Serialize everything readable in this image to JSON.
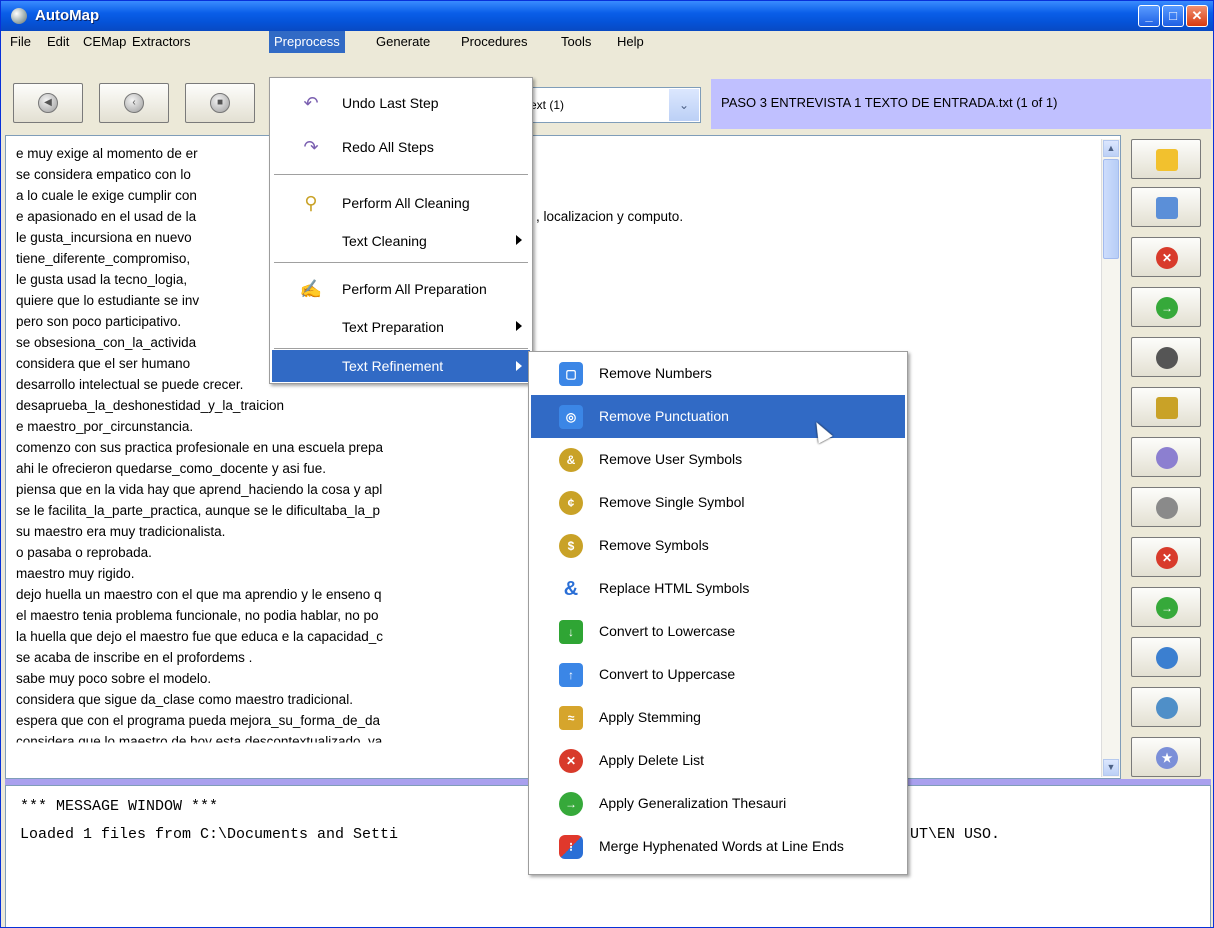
{
  "window": {
    "title": "AutoMap",
    "min_glyph": "_",
    "max_glyph": "□",
    "close_glyph": "✕"
  },
  "menubar": [
    {
      "label": "File"
    },
    {
      "label": "Edit"
    },
    {
      "label": "CEMap"
    },
    {
      "label": "Extractors"
    },
    {
      "label": "Preprocess"
    },
    {
      "label": "Generate"
    },
    {
      "label": "Procedures"
    },
    {
      "label": "Tools"
    },
    {
      "label": "Help"
    }
  ],
  "toolbar": {
    "nav_icons": [
      "first-icon",
      "previous-icon",
      "stop-icon"
    ],
    "file_select_value": "ext (1)",
    "combo_arrow": "⌄",
    "current_file": "PASO 3 ENTREVISTA 1 TEXTO DE ENTRADA.txt   (1 of 1)"
  },
  "text_lines": [
    "e muy exige al momento de er",
    "se considera empatico con lo",
    "a lo cuale le exige cumplir con",
    " e apasionado en el usad de la",
    " le gusta_incursiona en nuevo",
    " tiene_diferente_compromiso,",
    "le gusta usad la tecno_logia,",
    "quiere que lo estudiante se inv",
    "pero son poco participativo.",
    "se obsesiona_con_la_activida",
    "considera que el ser humano",
    " desarrollo intelectual se puede crecer.",
    "desaprueba_la_deshonestidad_y_la_traicion",
    "e maestro_por_circunstancia.",
    "comenzo con sus practica profesionale en una escuela prepa",
    "ahi le ofrecieron quedarse_como_docente y asi fue.",
    "piensa que en la vida hay que aprend_haciendo la cosa y apl",
    "se le facilita_la_parte_practica, aunque se le dificultaba_la_p",
    "su maestro era muy tradicionalista.",
    "o pasaba o reprobada.",
    "maestro muy rigido.",
    "dejo huella un maestro con el que ma aprendio y le enseno q",
    "el maestro tenia problema funcionale, no podia hablar, no po",
    "la huella que dejo el maestro fue que educa e la capacidad_c",
    "se acaba de inscribe en el profordems .",
    "sabe muy poco sobre el modelo.",
    "considera que sigue da_clase como maestro tradicional.",
    "espera que con el programa pueda mejora_su_forma_de_da",
    "considera que lo maestro de hoy esta descontextualizado, ya"
  ],
  "text_fragment": ", localizacion y computo.",
  "scrollbar": {
    "up": "▲",
    "down": "▼"
  },
  "right_tools": [
    {
      "icon": "open-folder-icon",
      "color": "#f2c12e",
      "glyph": ""
    },
    {
      "icon": "folder-image-icon",
      "color": "#5b8fd8",
      "glyph": ""
    },
    {
      "icon": "delete-list-icon",
      "color": "#d83b2b",
      "glyph": "✕"
    },
    {
      "icon": "thesaurus-icon",
      "color": "#36a93a",
      "glyph": "→"
    },
    {
      "icon": "stamp-icon",
      "color": "#555555",
      "glyph": ""
    },
    {
      "icon": "film-icon",
      "color": "#c9a227",
      "glyph": ""
    },
    {
      "icon": "globe-icon",
      "color": "#8c7fd0",
      "glyph": ""
    },
    {
      "icon": "disk-settings-icon",
      "color": "#8a8a8a",
      "glyph": ""
    },
    {
      "icon": "delete-list-edit-icon",
      "color": "#d83b2b",
      "glyph": "✕"
    },
    {
      "icon": "thesaurus-edit-icon",
      "color": "#36a93a",
      "glyph": "→"
    },
    {
      "icon": "image-settings-icon",
      "color": "#3b7fd0",
      "glyph": ""
    },
    {
      "icon": "map-icon",
      "color": "#4f8fc8",
      "glyph": ""
    },
    {
      "icon": "star-triangle-icon",
      "color": "#7b8fd8",
      "glyph": "★"
    }
  ],
  "message_window": {
    "header": "*** MESSAGE WINDOW ***",
    "line_left": "Loaded 1 files from C:\\Documents and Setti",
    "line_right": "UT\\EN USO."
  },
  "preprocess_menu": {
    "undo": "Undo Last Step",
    "redo": "Redo All Steps",
    "perform_cleaning": "Perform All Cleaning",
    "text_cleaning": "Text Cleaning",
    "perform_preparation": "Perform All Preparation",
    "text_preparation": "Text Preparation",
    "text_refinement": "Text Refinement"
  },
  "refinement_submenu": [
    {
      "label": "Remove Numbers",
      "icon": "square-blue-icon",
      "color": "#3b86e6",
      "glyph": "▢"
    },
    {
      "label": "Remove Punctuation",
      "icon": "target-blue-icon",
      "color": "#3b86e6",
      "glyph": "◎"
    },
    {
      "label": "Remove User Symbols",
      "icon": "coin-gold-icon",
      "color": "#c9a227",
      "glyph": "&"
    },
    {
      "label": "Remove Single Symbol",
      "icon": "coin-gold-icon",
      "color": "#c9a227",
      "glyph": "¢"
    },
    {
      "label": "Remove Symbols",
      "icon": "coin-gold-icon",
      "color": "#c9a227",
      "glyph": "$"
    },
    {
      "label": "Replace HTML Symbols",
      "icon": "ampersand-icon",
      "color": "#2a6fd6",
      "glyph": "&"
    },
    {
      "label": "Convert to Lowercase",
      "icon": "down-arrow-green-icon",
      "color": "#2fa534",
      "glyph": "↓"
    },
    {
      "label": "Convert to Uppercase",
      "icon": "up-arrow-blue-icon",
      "color": "#3b86e6",
      "glyph": "↑"
    },
    {
      "label": "Apply Stemming",
      "icon": "stemming-icon",
      "color": "#d6a52c",
      "glyph": "≈"
    },
    {
      "label": "Apply Delete List",
      "icon": "delete-red-icon",
      "color": "#d83b2b",
      "glyph": "✕"
    },
    {
      "label": "Apply Generalization Thesauri",
      "icon": "arrow-green-icon",
      "color": "#36a93a",
      "glyph": "→"
    },
    {
      "label": "Merge Hyphenated Words at Line Ends",
      "icon": "merge-icon",
      "color": "#e0382c",
      "glyph": "⁝"
    }
  ]
}
